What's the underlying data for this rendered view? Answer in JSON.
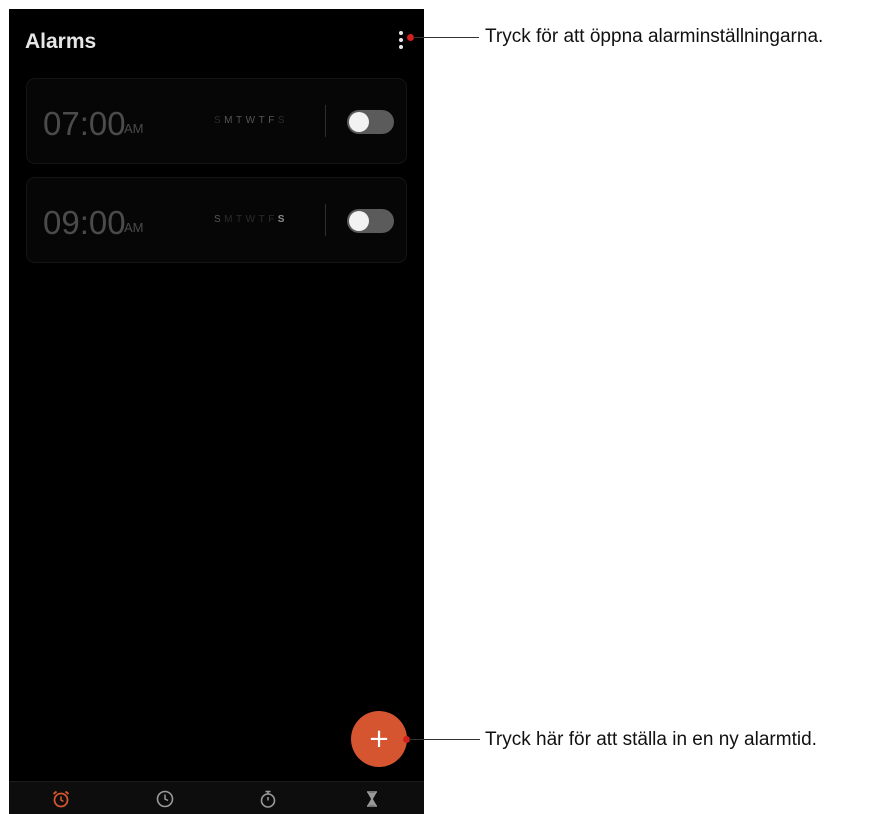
{
  "app": {
    "title": "Alarms"
  },
  "alarms": [
    {
      "time": "07:00",
      "period": "AM",
      "days": [
        {
          "letter": "S",
          "state": "dim"
        },
        {
          "letter": "M",
          "state": "on"
        },
        {
          "letter": "T",
          "state": "on"
        },
        {
          "letter": "W",
          "state": "on"
        },
        {
          "letter": "T",
          "state": "on"
        },
        {
          "letter": "F",
          "state": "on"
        },
        {
          "letter": "S",
          "state": "dim"
        }
      ],
      "enabled": false
    },
    {
      "time": "09:00",
      "period": "AM",
      "days": [
        {
          "letter": "S",
          "state": "on"
        },
        {
          "letter": "M",
          "state": "dim"
        },
        {
          "letter": "T",
          "state": "dim"
        },
        {
          "letter": "W",
          "state": "dim"
        },
        {
          "letter": "T",
          "state": "dim"
        },
        {
          "letter": "F",
          "state": "dim"
        },
        {
          "letter": "S",
          "state": "bold"
        }
      ],
      "enabled": false
    }
  ],
  "fab": {
    "label": "+"
  },
  "bottom_nav": [
    {
      "icon": "alarm-clock-icon",
      "active": true
    },
    {
      "icon": "clock-icon",
      "active": false
    },
    {
      "icon": "stopwatch-icon",
      "active": false
    },
    {
      "icon": "hourglass-icon",
      "active": false
    }
  ],
  "callouts": {
    "menu": "Tryck för att öppna alarminställningarna.",
    "add": "Tryck här för att ställa in en ny alarmtid."
  },
  "colors": {
    "accent": "#d4552f",
    "callout_dot": "#d41f1f",
    "background": "#000000"
  }
}
